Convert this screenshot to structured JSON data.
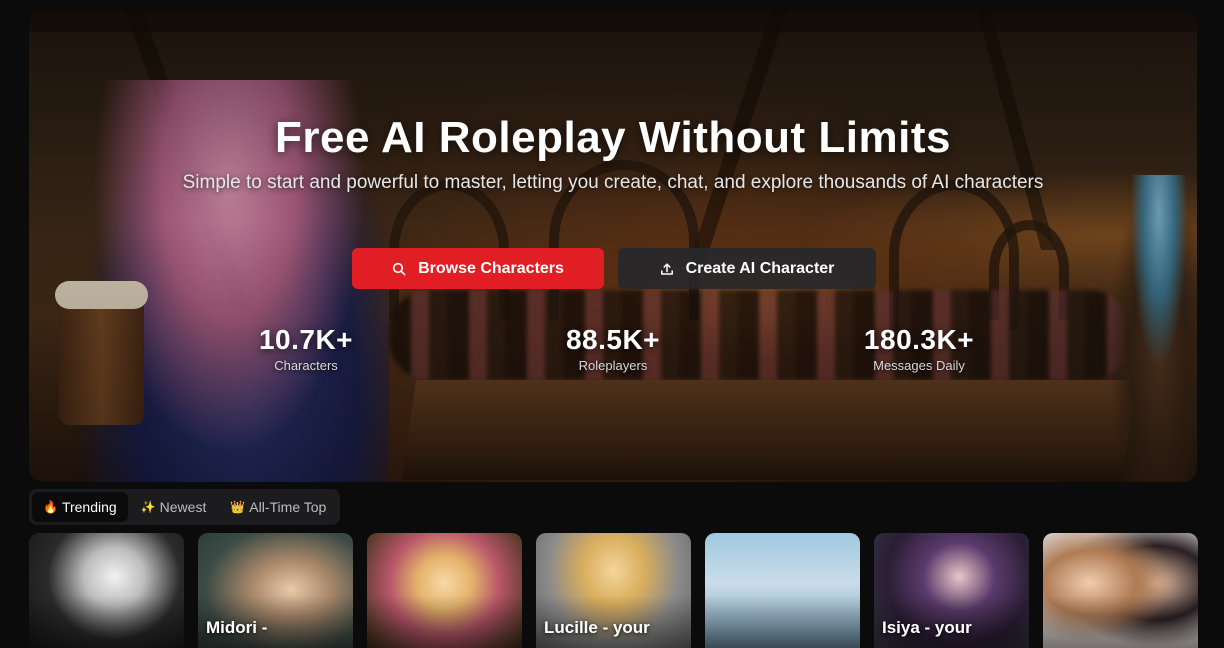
{
  "hero": {
    "title": "Free AI Roleplay Without Limits",
    "subtitle": "Simple to start and powerful to master, letting you create, chat, and explore thousands of AI characters",
    "browse_button": {
      "label": "Browse Characters",
      "icon": "search-icon",
      "color": "#e21e25"
    },
    "create_button": {
      "label": "Create AI Character",
      "icon": "upload-icon"
    },
    "stats": [
      {
        "value": "10.7K+",
        "label": "Characters"
      },
      {
        "value": "88.5K+",
        "label": "Roleplayers"
      },
      {
        "value": "180.3K+",
        "label": "Messages Daily"
      }
    ]
  },
  "tabs": [
    {
      "icon": "🔥",
      "icon_name": "fire-icon",
      "label": "Trending",
      "active": true
    },
    {
      "icon": "✨",
      "icon_name": "sparkles-icon",
      "label": "Newest",
      "active": false
    },
    {
      "icon": "👑",
      "icon_name": "crown-icon",
      "label": "All-Time Top",
      "active": false
    }
  ],
  "cards": [
    {
      "name": ""
    },
    {
      "name": "Midori -"
    },
    {
      "name": ""
    },
    {
      "name": "Lucille - your"
    },
    {
      "name": ""
    },
    {
      "name": "Isiya - your"
    },
    {
      "name": ""
    }
  ]
}
